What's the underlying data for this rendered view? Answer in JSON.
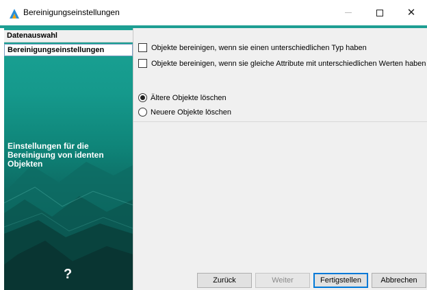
{
  "window": {
    "title": "Bereinigungseinstellungen",
    "minimize_glyph": "—",
    "maximize_glyph": "☐",
    "close_glyph": "✕"
  },
  "nav": {
    "items": [
      {
        "label": "Datenauswahl"
      },
      {
        "label": "Bereinigungseinstellungen"
      }
    ],
    "description": "Einstellungen für die Bereinigung von identen Objekten",
    "help_glyph": "?"
  },
  "options": {
    "checkboxes": [
      {
        "label": "Objekte bereinigen, wenn sie einen unterschiedlichen Typ haben",
        "checked": false
      },
      {
        "label": "Objekte bereinigen, wenn sie gleiche Attribute mit unterschiedlichen Werten haben",
        "checked": false
      }
    ],
    "radios": [
      {
        "label": "Ältere Objekte löschen",
        "selected": true
      },
      {
        "label": "Neuere Objekte löschen",
        "selected": false
      }
    ]
  },
  "buttons": {
    "back": "Zurück",
    "next": "Weiter",
    "finish": "Fertigstellen",
    "cancel": "Abbrechen"
  },
  "colors": {
    "accent": "#1e9e93",
    "panel_top": "#1aa394",
    "panel_bottom": "#0b4a46"
  }
}
